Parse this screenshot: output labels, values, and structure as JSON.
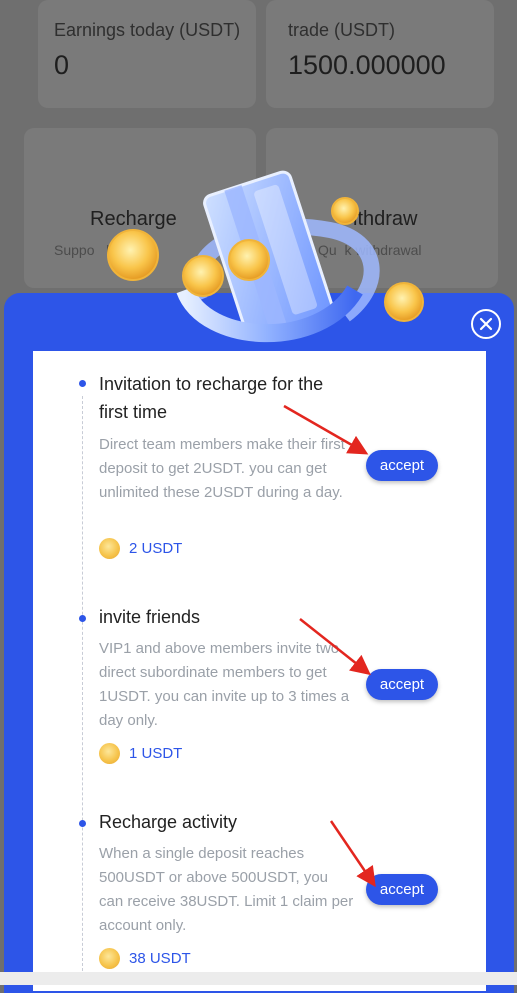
{
  "background": {
    "earnings_label": "Earnings today (USDT)",
    "earnings_value": "0",
    "trade_label": "trade (USDT)",
    "trade_value": "1500.000000",
    "recharge_title": "Recharge",
    "recharge_sub": "Suppo   le way",
    "withdraw_title": "ithdraw",
    "withdraw_sub": "Qu  k withdrawal"
  },
  "modal": {
    "close_icon": "close-circle-icon",
    "tasks": [
      {
        "title": "Invitation to recharge for the first time",
        "description": "Direct team members make their first deposit to get 2USDT. you can get unlimited these 2USDT during a day.",
        "reward": "2 USDT",
        "button": "accept"
      },
      {
        "title": "invite friends",
        "description": "VIP1 and above members invite two direct subordinate members to get 1USDT. you can invite up to 3 times a day only.",
        "reward": "1 USDT",
        "button": "accept"
      },
      {
        "title": "Recharge activity",
        "description": "When a single deposit reaches 500USDT or above 500USDT, you can receive 38USDT. Limit 1 claim per account only.",
        "reward": "38 USDT",
        "button": "accept"
      }
    ]
  },
  "colors": {
    "accent": "#2d55e8",
    "coin": "#f6c44c",
    "annotation_arrow": "#e3261f"
  }
}
